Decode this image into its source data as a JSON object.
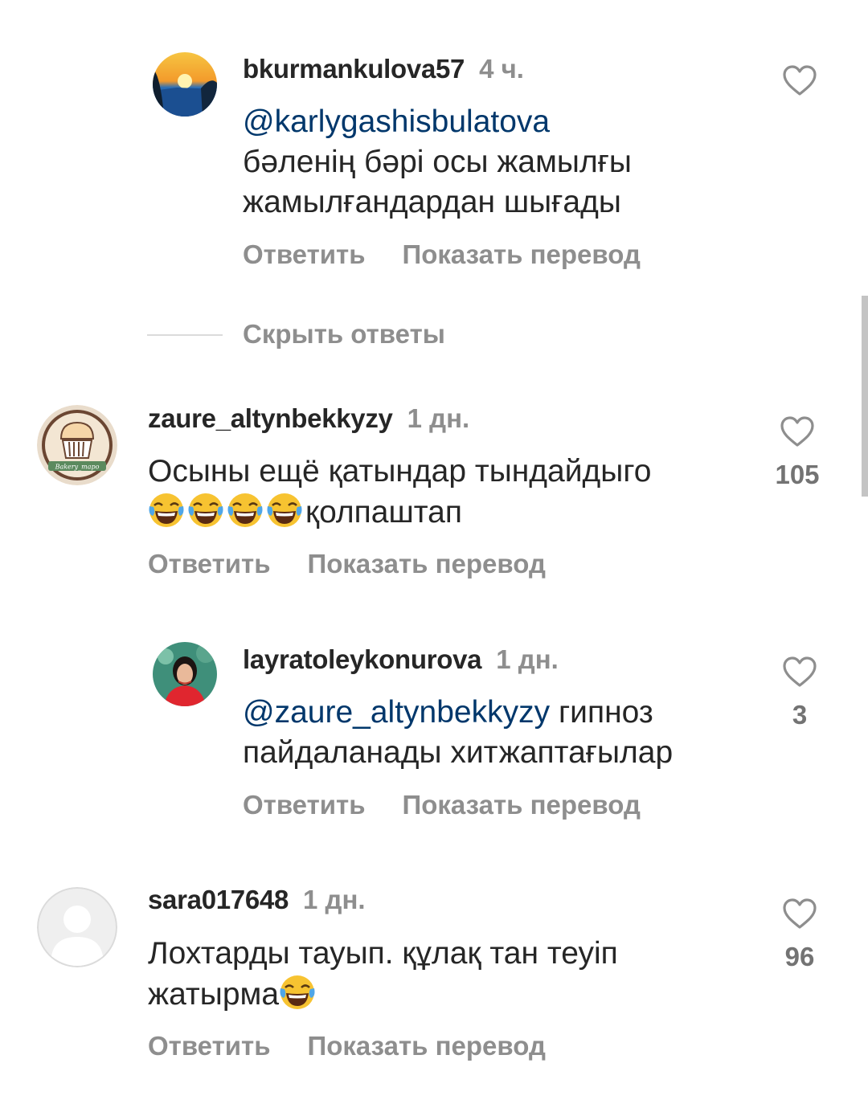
{
  "comments": [
    {
      "username": "bkurmankulova57",
      "time": "4 ч.",
      "mention": "@karlygashisbulatova",
      "text_line1": "бәленің бәрі осы жамылғы",
      "text_line2": "жамылғандардан шығады",
      "reply_label": "Ответить",
      "translate_label": "Показать перевод",
      "likes": ""
    },
    {
      "username": "zaure_altynbekkyzy",
      "time": "1 дн.",
      "text_line1": "Осыны ещё қатындар тындайдыго",
      "text_line2": "қолпаштап",
      "reply_label": "Ответить",
      "translate_label": "Показать перевод",
      "likes": "105"
    },
    {
      "username": "layratoleykonurova",
      "time": "1 дн.",
      "mention": "@zaure_altynbekkyzy",
      "text_line1": " гипноз",
      "text_line2": "пайдаланады хитжаптағылар",
      "reply_label": "Ответить",
      "translate_label": "Показать перевод",
      "likes": "3"
    },
    {
      "username": "sara017648",
      "time": "1 дн.",
      "text_line1": "Лохтарды тауып.  құлақ тан теуіп",
      "text_line2": "жатырма",
      "reply_label": "Ответить",
      "translate_label": "Показать перевод",
      "likes": "96"
    }
  ],
  "hide_replies_label": "Скрыть ответы",
  "icons": {
    "like": "heart-outline-icon",
    "emoji": "face-with-tears-of-joy-icon",
    "avatar_default": "default-avatar-icon"
  },
  "avatar_logo_text": "Bakery_mapo",
  "colors": {
    "mention": "#00376b",
    "secondary_text": "#8e8e8e",
    "primary_text": "#262626"
  }
}
